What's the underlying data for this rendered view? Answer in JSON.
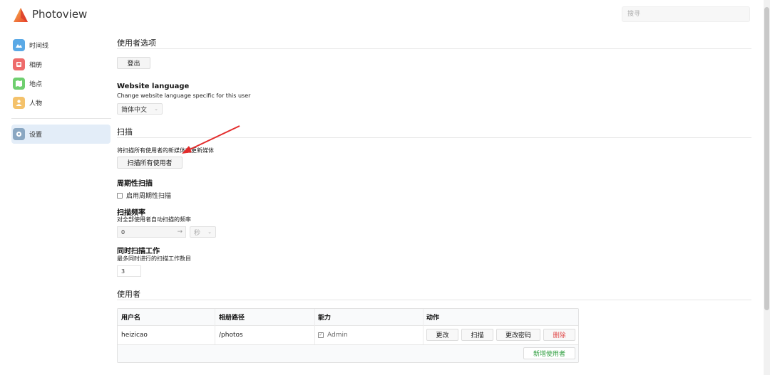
{
  "app": {
    "title": "Photoview"
  },
  "search": {
    "placeholder": "搜寻"
  },
  "sidebar": {
    "items": [
      {
        "label": "时间线",
        "icon": "timeline-icon",
        "color": "#5aa9e6"
      },
      {
        "label": "相册",
        "icon": "album-icon",
        "color": "#ee6b6b"
      },
      {
        "label": "地点",
        "icon": "map-icon",
        "color": "#6fcf6f"
      },
      {
        "label": "人物",
        "icon": "person-icon",
        "color": "#f4c26b"
      }
    ],
    "settings": {
      "label": "设置",
      "icon": "gear-icon",
      "color": "#8aa7c2"
    }
  },
  "user_prefs": {
    "title": "使用者选项",
    "logout_label": "登出",
    "language_title": "Website language",
    "language_desc": "Change website language specific for this user",
    "language_value": "简体中文"
  },
  "scan": {
    "title": "扫描",
    "desc": "将扫描所有使用者的新媒体或更新媒体",
    "scan_all_label": "扫描所有使用者",
    "periodic_title": "周期性扫描",
    "periodic_checkbox_label": "启用周期性扫描",
    "frequency_title": "扫描频率",
    "frequency_desc": "对全部使用者自动扫描的频率",
    "frequency_value": "0",
    "frequency_unit": "秒",
    "concurrent_title": "同时扫描工作",
    "concurrent_desc": "最多同时进行的扫描工作数目",
    "concurrent_value": "3"
  },
  "users": {
    "title": "使用者",
    "columns": [
      "用户名",
      "相册路径",
      "能力",
      "动作"
    ],
    "rows": [
      {
        "username": "heizicao",
        "path": "/photos",
        "capability": "Admin"
      }
    ],
    "actions": {
      "edit": "更改",
      "scan": "扫描",
      "change_password": "更改密码",
      "delete": "删除"
    },
    "add_user_label": "新增使用者"
  },
  "colors": {
    "accent": "#1d9bf0",
    "delete": "#e04848",
    "add_user": "#2e9e3e",
    "arrow": "#e32b2b"
  }
}
